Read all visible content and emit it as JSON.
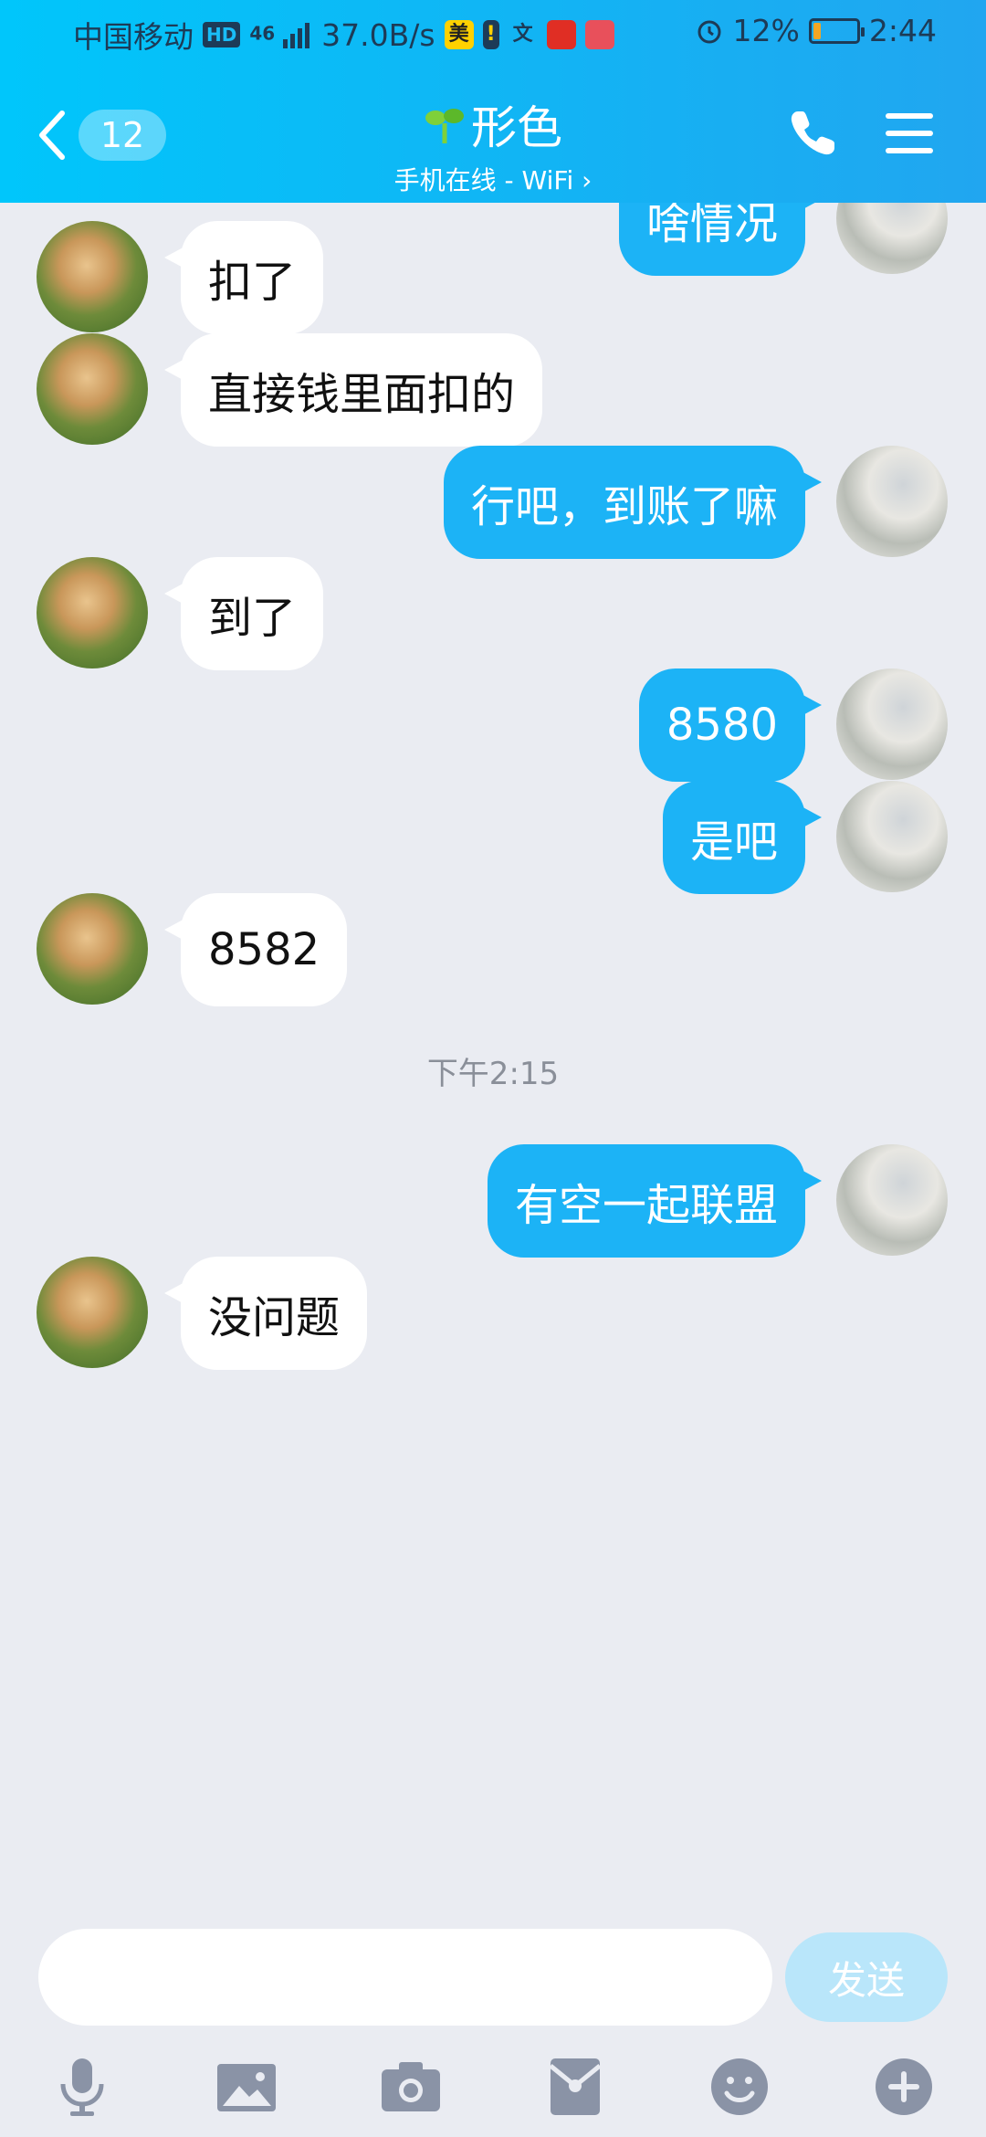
{
  "status_bar": {
    "carrier": "中国移动",
    "hd": "HD",
    "network": "46",
    "speed": "37.0B/s",
    "app_icon_1": "美",
    "battery_percent": "12%",
    "time": "2:44"
  },
  "header": {
    "unread_count": "12",
    "contact_name": "形色",
    "status": "手机在线 - WiFi",
    "status_chevron": "›"
  },
  "messages": [
    {
      "side": "out",
      "text": "啥情况"
    },
    {
      "side": "in",
      "text": "扣了"
    },
    {
      "side": "in",
      "text": "直接钱里面扣的"
    },
    {
      "side": "out",
      "text": "行吧，到账了嘛"
    },
    {
      "side": "in",
      "text": "到了"
    },
    {
      "side": "out",
      "text": "8580"
    },
    {
      "side": "out",
      "text": "是吧"
    },
    {
      "side": "in",
      "text": "8582"
    },
    {
      "side": "time",
      "text": "下午2:15"
    },
    {
      "side": "out",
      "text": "有空一起联盟"
    },
    {
      "side": "in",
      "text": "没问题"
    }
  ],
  "input": {
    "value": "",
    "send_label": "发送"
  },
  "toolbar": {
    "items": [
      "microphone-icon",
      "image-icon",
      "camera-icon",
      "red-packet-icon",
      "emoji-icon",
      "plus-icon"
    ]
  },
  "colors": {
    "header_start": "#00c6fb",
    "header_end": "#21a6f0",
    "out_bubble": "#1cb3f6",
    "in_bubble": "#ffffff",
    "background": "#eaecf2",
    "send_disabled": "#b9e6fa"
  }
}
